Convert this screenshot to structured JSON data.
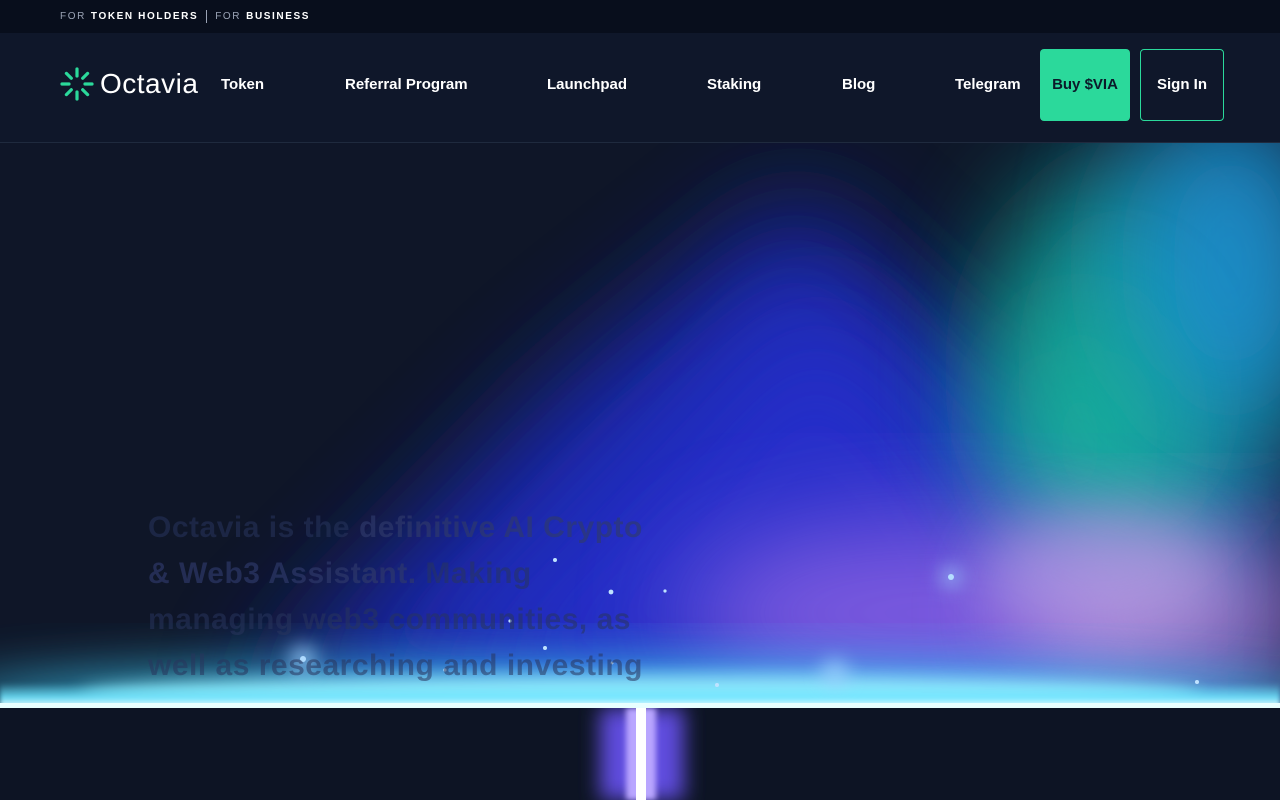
{
  "topbar": {
    "for_label_1": "FOR",
    "link_1": "TOKEN HOLDERS",
    "for_label_2": "FOR",
    "link_2": "BUSINESS"
  },
  "brand": {
    "name": "Octavia",
    "logo_icon": "octavia-logo-icon",
    "accent": "#2bd99b"
  },
  "nav": {
    "items": [
      {
        "label": "Token"
      },
      {
        "label": "Referral Program"
      },
      {
        "label": "Launchpad"
      },
      {
        "label": "Staking"
      },
      {
        "label": "Blog"
      },
      {
        "label": "Telegram"
      }
    ],
    "buy_label": "Buy $VIA",
    "signin_label": "Sign In"
  },
  "hero": {
    "name": "Octavia",
    "is_the": " is the ",
    "highlight": "definitive AI Crypto & Web3 Assistant.",
    "rest": " Making managing web3 communities, as well as researching and investing"
  },
  "colors": {
    "background": "#0f172a",
    "accent": "#2bd99b",
    "glow": "#7de9ff"
  }
}
